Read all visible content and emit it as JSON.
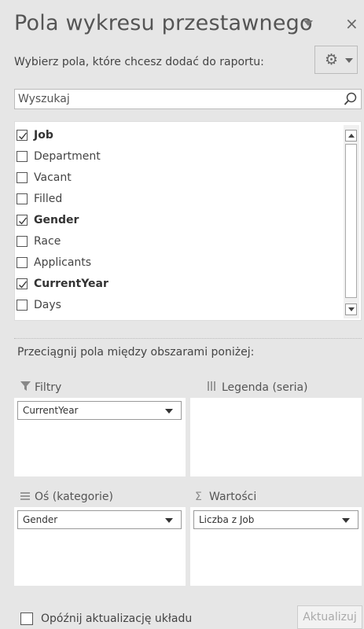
{
  "panel": {
    "title": "Pola wykresu przestawnego",
    "close_glyph": "×",
    "subtitle": "Wybierz pola, które chcesz dodać do raportu:",
    "gear_glyph": "⚙"
  },
  "search": {
    "placeholder": "Wyszukaj"
  },
  "fields": [
    {
      "label": "Job",
      "checked": true
    },
    {
      "label": "Department",
      "checked": false
    },
    {
      "label": "Vacant",
      "checked": false
    },
    {
      "label": "Filled",
      "checked": false
    },
    {
      "label": "Gender",
      "checked": true
    },
    {
      "label": "Race",
      "checked": false
    },
    {
      "label": "Applicants",
      "checked": false
    },
    {
      "label": "CurrentYear",
      "checked": true
    },
    {
      "label": "Days",
      "checked": false
    }
  ],
  "areas": {
    "drag_label": "Przeciągnij pola między obszarami poniżej:",
    "filters": {
      "title": "Filtry",
      "icon": "filter-icon",
      "item": "CurrentYear"
    },
    "legend": {
      "title": "Legenda (seria)",
      "icon": "columns-icon"
    },
    "axis": {
      "title": "Oś (kategorie)",
      "icon": "rows-icon",
      "item": "Gender"
    },
    "values": {
      "title": "Wartości",
      "icon": "sigma-icon",
      "glyph": "Σ",
      "item": "Liczba z Job"
    }
  },
  "footer": {
    "defer_label": "Opóźnij aktualizację układu",
    "update_label": "Aktualizuj"
  }
}
